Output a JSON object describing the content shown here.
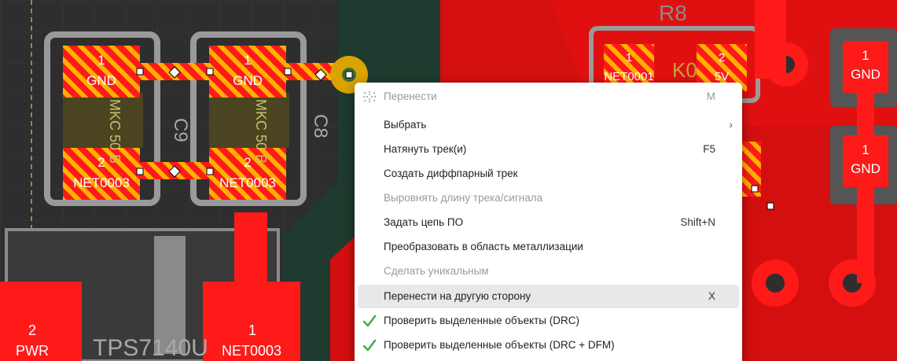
{
  "pcb": {
    "pads": {
      "c9_top_num": "1",
      "c9_top_net": "GND",
      "c8_top_num": "1",
      "c8_top_net": "GND",
      "c9_bot_num": "2",
      "c9_bot_net": "NET0003",
      "c8_bot_num": "2",
      "c8_bot_net": "NET0003",
      "r8_left_num": "1",
      "r8_left_net": "NET0001",
      "r8_right_num": "2",
      "r8_right_net": "5V",
      "right_top_num": "1",
      "right_top_net": "GND",
      "right_mid_num": "1",
      "right_mid_net": "GND",
      "big_left_num": "2",
      "big_left_net": "PWR",
      "big_mid_num": "1",
      "big_mid_net": "NET0003"
    },
    "silk": {
      "c9": "C9",
      "c8": "C8",
      "r8": "R8",
      "cap_value": "MKC 50 B",
      "res_value": "K0",
      "ic_label": "TPS7140U"
    }
  },
  "context_menu": {
    "items": [
      {
        "label": "Перенести",
        "shortcut": "M",
        "disabled": true,
        "icon": "move-dots-icon"
      },
      {
        "label": "Выбрать",
        "submenu_arrow": "›"
      },
      {
        "label": "Натянуть трек(и)",
        "shortcut": "F5"
      },
      {
        "label": "Создать диффпарный трек"
      },
      {
        "label": "Выровнять длину трека/сигнала",
        "disabled": true
      },
      {
        "label": "Задать цепь ПО",
        "shortcut": "Shift+N"
      },
      {
        "label": "Преобразовать в область металлизации"
      },
      {
        "label": "Сделать уникальным",
        "disabled": true
      },
      {
        "label": "Перенести на другую сторону",
        "shortcut": "X",
        "highlighted": true
      },
      {
        "label": "Проверить выделенные объекты (DRC)",
        "icon": "checkmark-icon"
      },
      {
        "label": "Проверить выделенные объекты (DRC + DFM)",
        "icon": "checkmark-icon"
      }
    ]
  },
  "colors": {
    "board": "#2b2b2b",
    "copper_pour": "#1f3a2e",
    "pad_red": "#ff1a1a",
    "pad_hatch": "#ffb000",
    "silk_gray": "#a8a8a8",
    "courtyard": "#6a6a6a",
    "menu_bg": "#ffffff",
    "disabled_text": "#9a9a9a",
    "check_green": "#3fae49"
  }
}
